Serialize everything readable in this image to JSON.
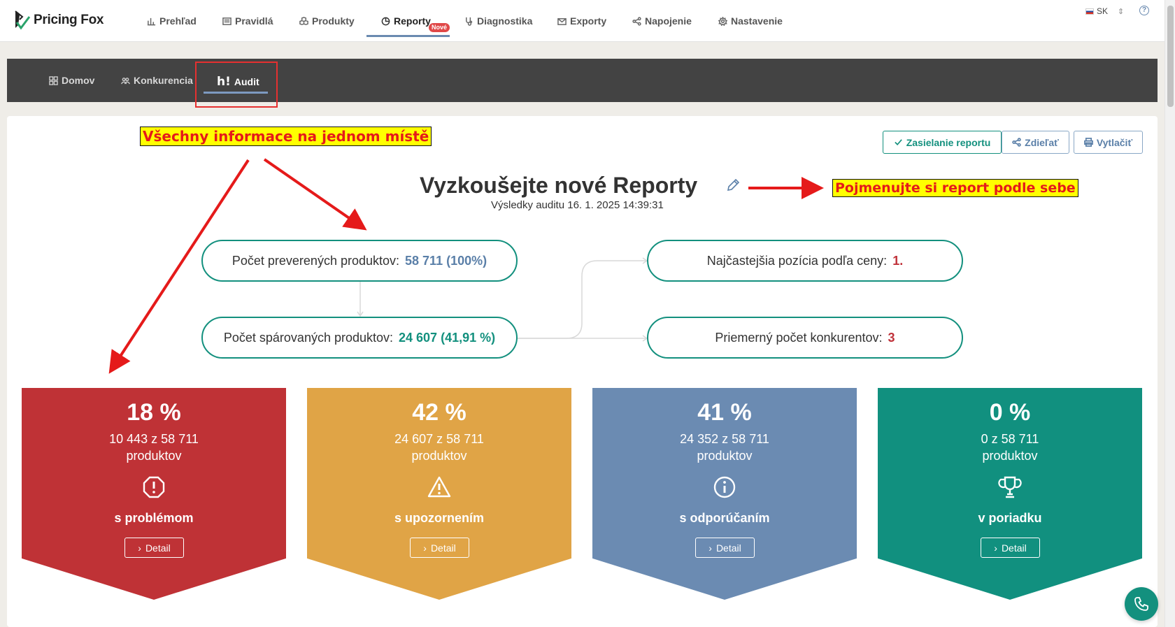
{
  "brand": {
    "name": "Pricing Fox"
  },
  "topnav": {
    "items": [
      {
        "label": "Prehľad",
        "icon": "bar-chart-icon"
      },
      {
        "label": "Pravidlá",
        "icon": "list-icon"
      },
      {
        "label": "Produkty",
        "icon": "cubes-icon"
      },
      {
        "label": "Reporty",
        "icon": "pie-chart-icon",
        "active": true,
        "badge": "Nové"
      },
      {
        "label": "Diagnostika",
        "icon": "stethoscope-icon"
      },
      {
        "label": "Exporty",
        "icon": "export-icon"
      },
      {
        "label": "Napojenie",
        "icon": "share-nodes-icon"
      },
      {
        "label": "Nastavenie",
        "icon": "gear-icon"
      }
    ],
    "language": "SK"
  },
  "subnav": {
    "items": [
      {
        "label": "Domov",
        "icon": "grid-icon"
      },
      {
        "label": "Konkurencia",
        "icon": "users-icon"
      },
      {
        "label": "Audit",
        "icon": "heureka-icon",
        "prefix": "h!",
        "active": true
      }
    ]
  },
  "actions": {
    "send_report": "Zasielanie reportu",
    "share": "Zdieľať",
    "print": "Vytlačiť"
  },
  "report": {
    "title": "Vyzkoušejte nové Reporty",
    "subtitle": "Výsledky auditu 16. 1. 2025 14:39:31"
  },
  "flow": {
    "checked": {
      "label": "Počet preverených produktov:",
      "value": "58 711 (100%)"
    },
    "matched": {
      "label": "Počet spárovaných produktov:",
      "value": "24 607 (41,91 %)"
    },
    "position": {
      "label": "Najčastejšia pozícia podľa ceny:",
      "value": "1."
    },
    "competitors": {
      "label": "Priemerný počet konkurentov:",
      "value": "3"
    }
  },
  "tiles": [
    {
      "pct": "18 %",
      "count": "10 443 z 58 711",
      "unit": "produktov",
      "label": "s problémom",
      "button": "Detail",
      "color": "#bf3236",
      "icon": "octagon-exclamation-icon"
    },
    {
      "pct": "42 %",
      "count": "24 607 z 58 711",
      "unit": "produktov",
      "label": "s upozornením",
      "button": "Detail",
      "color": "#e0a446",
      "icon": "warning-triangle-icon"
    },
    {
      "pct": "41 %",
      "count": "24 352 z 58 711",
      "unit": "produktov",
      "label": "s odporúčaním",
      "button": "Detail",
      "color": "#6b8bb2",
      "icon": "info-circle-icon"
    },
    {
      "pct": "0 %",
      "count": "0 z 58 711",
      "unit": "produktov",
      "label": "v poriadku",
      "button": "Detail",
      "color": "#11907f",
      "icon": "trophy-icon"
    }
  ],
  "annotations": {
    "all_in_one": "Všechny informace na jednom místě",
    "rename": "Pojmenujte si report podle sebe"
  },
  "colors": {
    "accent_teal": "#13907e",
    "accent_blue": "#5a7fa8",
    "red": "#c0323a",
    "subnav_bg": "#434343"
  }
}
